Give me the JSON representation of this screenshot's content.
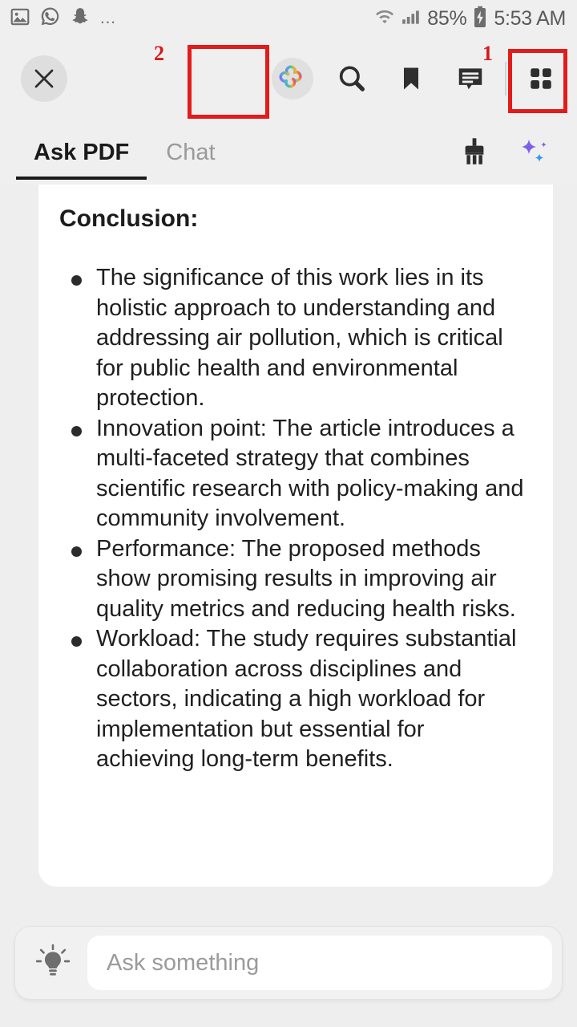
{
  "status_bar": {
    "left_icons": [
      "gallery-icon",
      "whatsapp-icon",
      "snapchat-icon",
      "more-dots-icon"
    ],
    "right_icons": [
      "wifi-icon",
      "cellular-signal-icon",
      "battery-charging-icon"
    ],
    "battery_percent": "85%",
    "time": "5:53 AM"
  },
  "toolbar": {
    "close_label": "×",
    "items": [
      {
        "name": "close-button",
        "label": "close"
      },
      {
        "name": "ai-assistant-logo-button",
        "label": "AI assistant"
      },
      {
        "name": "search-button",
        "label": "Search"
      },
      {
        "name": "bookmark-button",
        "label": "Bookmark"
      },
      {
        "name": "comments-button",
        "label": "Comments"
      },
      {
        "name": "grid-view-button",
        "label": "Grid view"
      }
    ],
    "annotations": [
      {
        "number": "1",
        "target": "grid-view-button"
      },
      {
        "number": "2",
        "target": "ai-assistant-logo-button"
      }
    ],
    "annotation_color": "#e21b1b"
  },
  "tabs": {
    "items": [
      {
        "label": "Ask PDF",
        "active": true
      },
      {
        "label": "Chat",
        "active": false
      }
    ],
    "actions": [
      {
        "name": "brush-button",
        "label": "Clear"
      },
      {
        "name": "ai-sparkle-button",
        "label": "AI"
      }
    ]
  },
  "content": {
    "title": "Conclusion:",
    "bullets": [
      "The significance of this work lies in its holistic approach to understanding and addressing air pollution, which is critical for public health and environmental protection.",
      "Innovation point: The article introduces a multi-faceted strategy that combines scientific research with policy-making and community involvement.",
      "Performance: The proposed methods show promising results in improving air quality metrics and reducing health risks.",
      "Workload: The study requires substantial collaboration across disciplines and sectors, indicating a high workload for implementation but essential for achieving long-term benefits."
    ]
  },
  "composer": {
    "suggestion_icon": "lightbulb-icon",
    "placeholder": "Ask something",
    "value": ""
  },
  "colors": {
    "page_bg": "#eeeeee",
    "card_bg": "#ffffff",
    "accent_purple": "#7b61e8",
    "accent_blue": "#2f9bf5",
    "annotation_red": "#e21b1b",
    "text_primary": "#1f1f1f",
    "text_muted": "#9a9a9a"
  }
}
